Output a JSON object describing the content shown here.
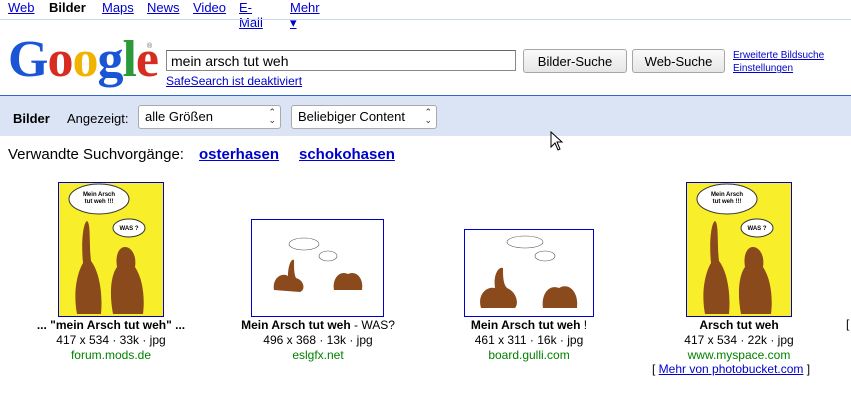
{
  "topnav": {
    "web": "Web",
    "bilder": "Bilder",
    "maps": "Maps",
    "news": "News",
    "video": "Video",
    "email": "E-Mail",
    "mehr": "Mehr ▾"
  },
  "logo": {
    "text": "Google"
  },
  "search": {
    "query": "mein arsch tut weh",
    "image_search_button": "Bilder-Suche",
    "web_search_button": "Web-Suche",
    "safesearch": "SafeSearch ist deaktiviert",
    "advanced": "Erweiterte Bildsuche",
    "settings": "Einstellungen"
  },
  "filterbar": {
    "title": "Bilder",
    "shown_label": "Angezeigt:",
    "size_value": "alle Größen",
    "content_value": "Beliebiger Content"
  },
  "related": {
    "label": "Verwandte Suchvorgänge:",
    "items": [
      "osterhasen",
      "schokohasen"
    ]
  },
  "results": [
    {
      "title_prefix": "... \"mein Arsch tut weh\" ...",
      "title_suffix": "",
      "meta": "417 x 534 · 33k · jpg",
      "source": "forum.mods.de",
      "bubble1": "Mein Arsch tut weh !!!",
      "bubble2": "WAS ?"
    },
    {
      "title_prefix": "Mein Arsch tut weh",
      "title_suffix": " - WAS?",
      "meta": "496 x 368 · 13k · jpg",
      "source": "eslgfx.net"
    },
    {
      "title_prefix": "Mein Arsch tut weh",
      "title_suffix": " !",
      "meta": "461 x 311 · 16k · jpg",
      "source": "board.gulli.com"
    },
    {
      "title_prefix": "Arsch tut weh",
      "title_suffix": "",
      "meta": "417 x 534 · 22k · jpg",
      "source": "www.myspace.com",
      "bubble1": "Mein Arsch tut weh !!!",
      "bubble2": "WAS ?"
    }
  ],
  "more_from": {
    "open": "[ ",
    "link": "Mehr von photobucket.com",
    "close": " ]"
  },
  "edge_bracket": "["
}
